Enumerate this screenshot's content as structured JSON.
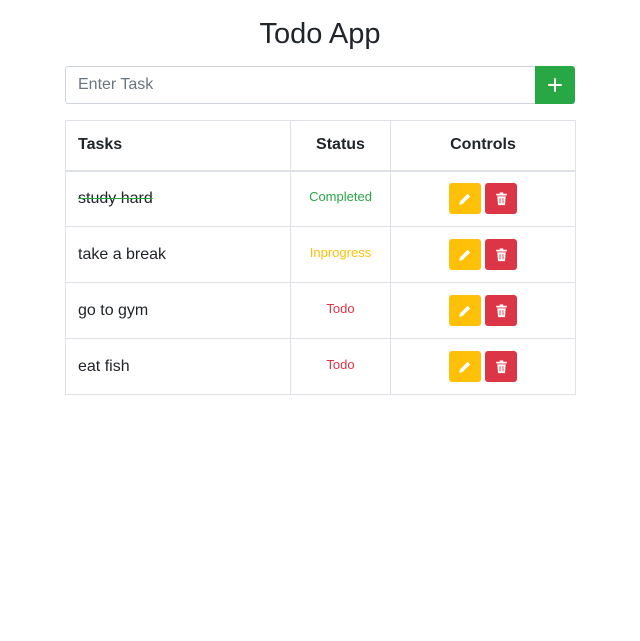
{
  "header": {
    "title": "Todo App"
  },
  "input": {
    "placeholder": "Enter Task",
    "value": ""
  },
  "table": {
    "headers": {
      "task": "Tasks",
      "status": "Status",
      "controls": "Controls"
    },
    "rows": [
      {
        "task": "study hard",
        "status": "Completed",
        "status_color": "#28a745",
        "done": true
      },
      {
        "task": "take a break",
        "status": "Inprogress",
        "status_color": "#ffc107",
        "done": false
      },
      {
        "task": "go to gym",
        "status": "Todo",
        "status_color": "#dc3545",
        "done": false
      },
      {
        "task": "eat fish",
        "status": "Todo",
        "status_color": "#dc3545",
        "done": false
      }
    ]
  },
  "colors": {
    "add": "#28a745",
    "edit": "#ffc107",
    "delete": "#dc3545"
  },
  "icons": {
    "add": "plus-icon",
    "edit": "pencil-icon",
    "delete": "trash-icon"
  }
}
